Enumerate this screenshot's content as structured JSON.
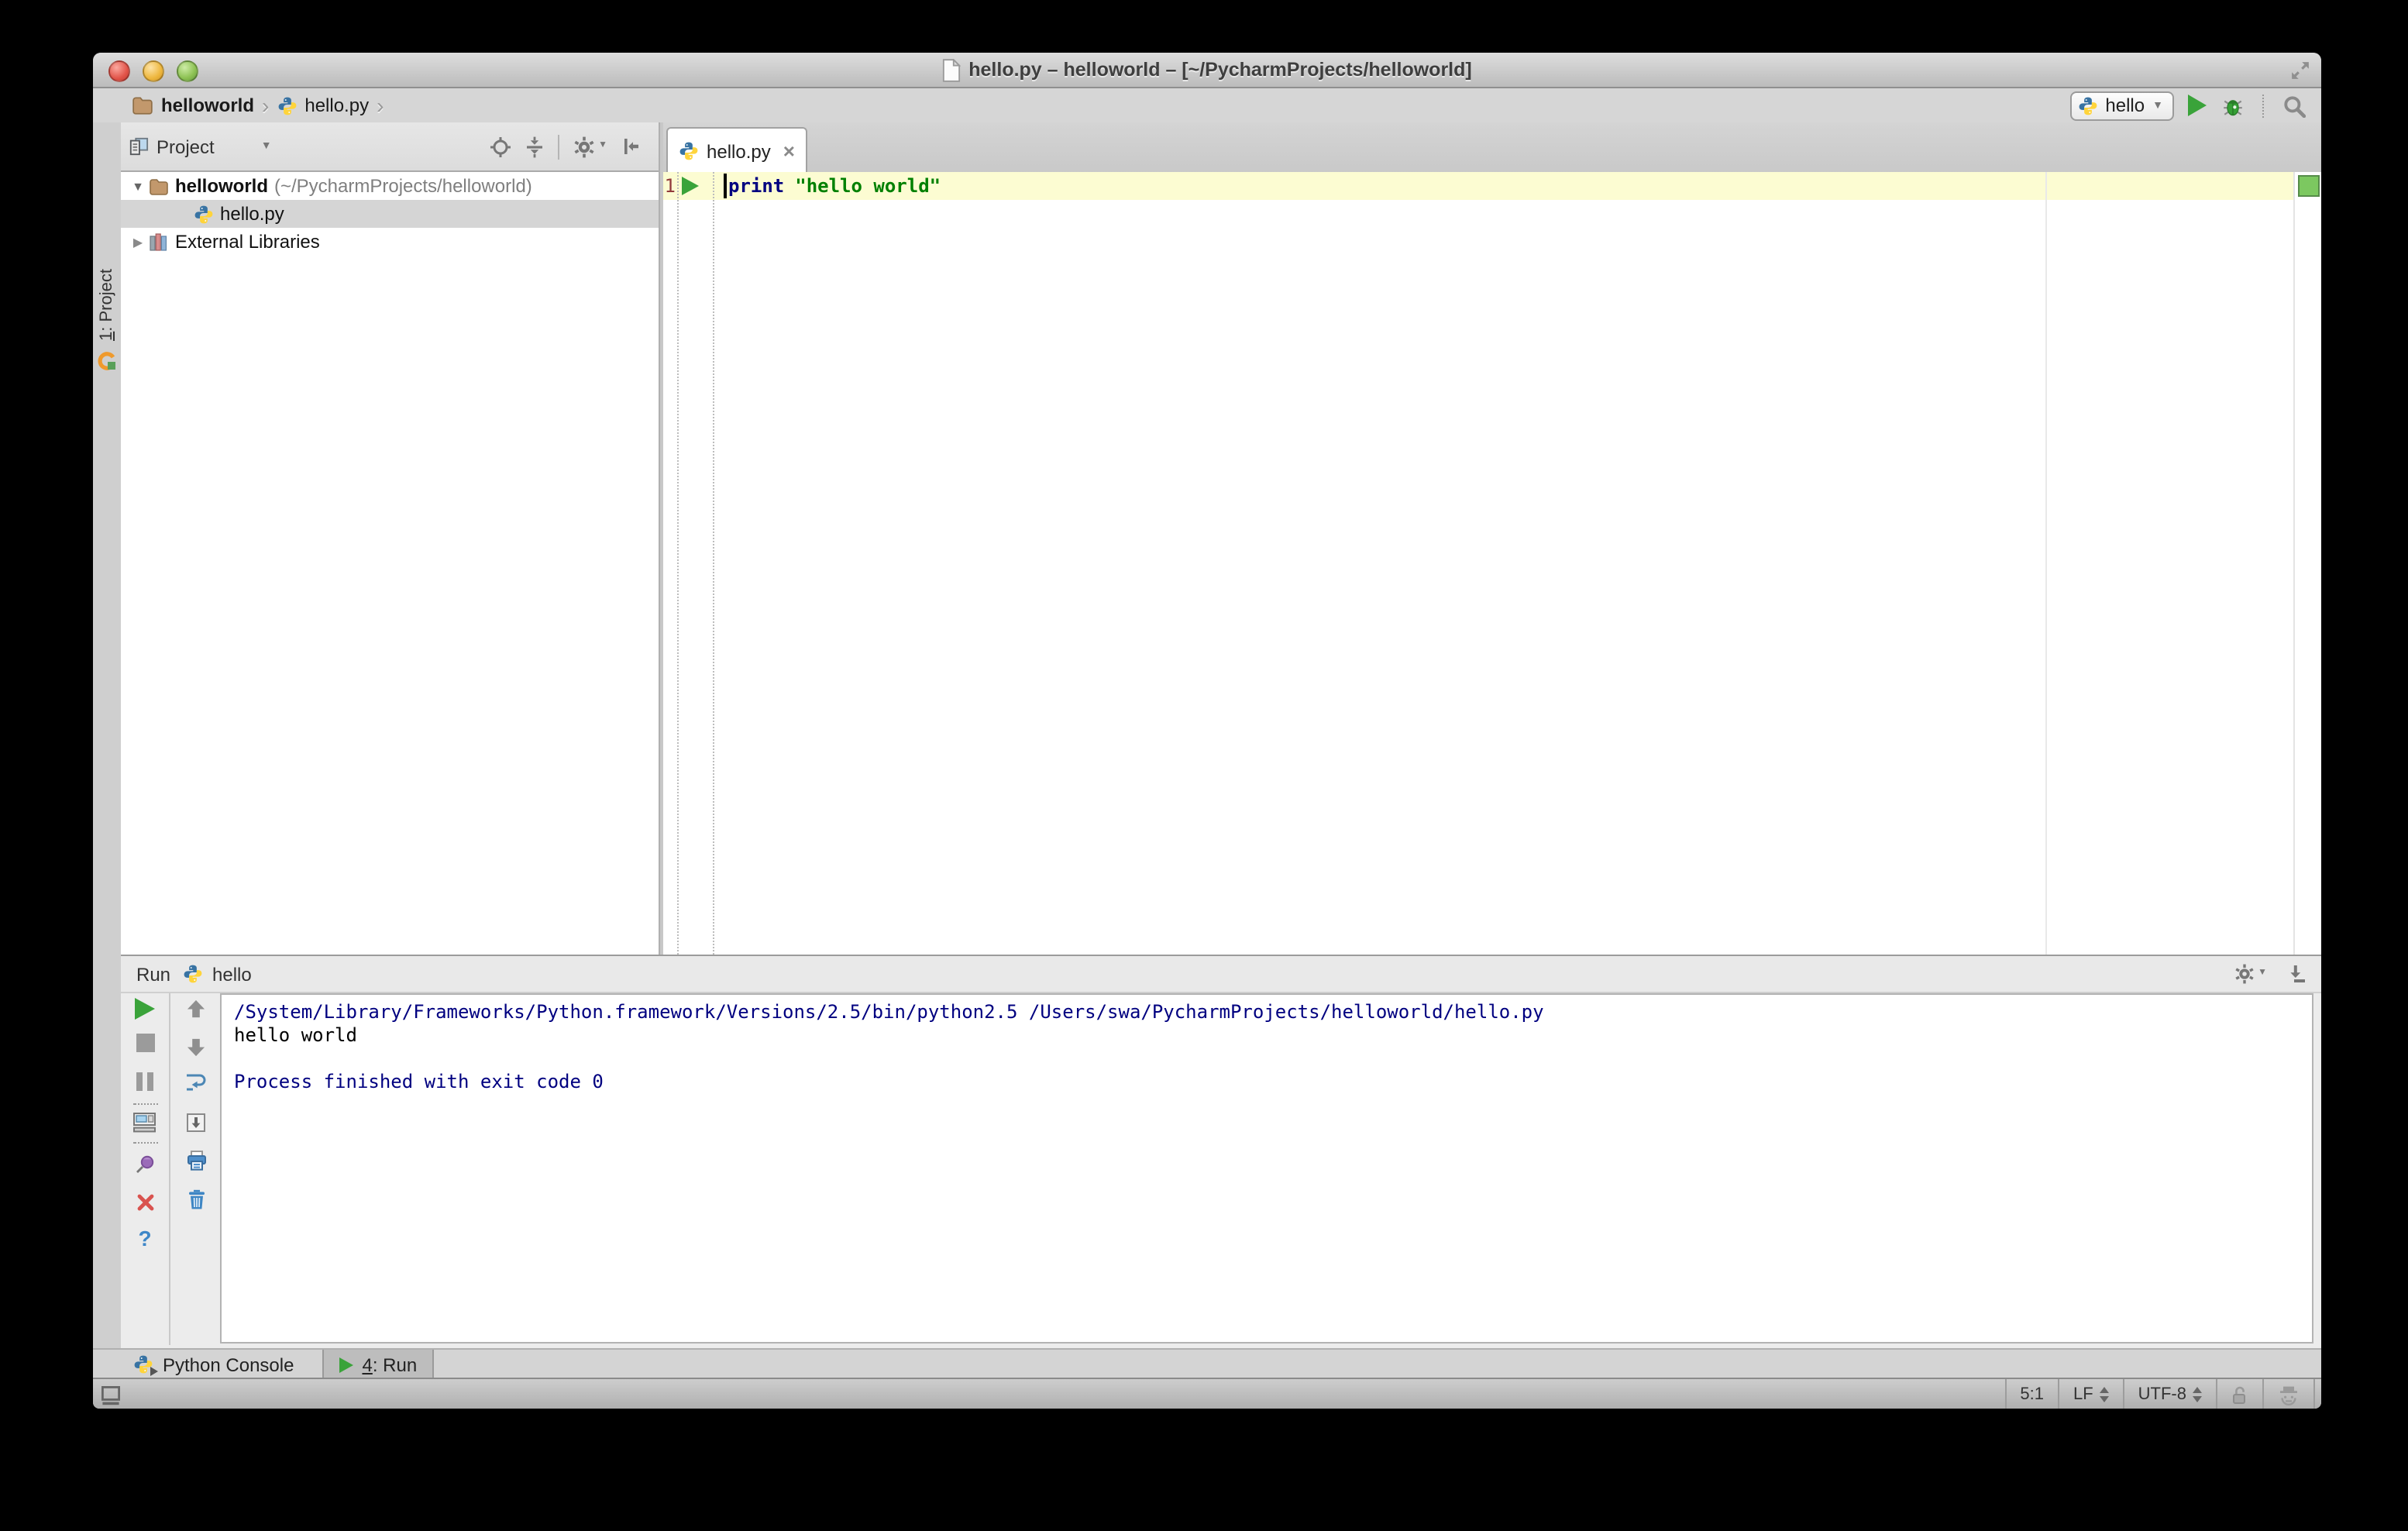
{
  "titlebar": {
    "title": "hello.py – helloworld – [~/PycharmProjects/helloworld]"
  },
  "navbar": {
    "crumb_project": "helloworld",
    "crumb_file": "hello.py"
  },
  "toolbar": {
    "run_config": "hello"
  },
  "left_stripe": {
    "project_btn_number": "1",
    "project_btn_rest": ": Project"
  },
  "project_panel": {
    "title": "Project",
    "tree": {
      "root_name": "helloworld",
      "root_path": "(~/PycharmProjects/helloworld)",
      "file": "hello.py",
      "libraries": "External Libraries"
    }
  },
  "editor": {
    "tab_label": "hello.py",
    "line_number": "1",
    "code_keyword": "print",
    "code_string": "\"hello world\""
  },
  "run_panel": {
    "label": "Run",
    "config": "hello",
    "console": {
      "command_line": "/System/Library/Frameworks/Python.framework/Versions/2.5/bin/python2.5 /Users/swa/PycharmProjects/helloworld/hello.py",
      "output_line": "hello world",
      "exit_line": "Process finished with exit code 0"
    }
  },
  "bottom_bar": {
    "python_console_label": "Python Console",
    "run_tab_number": "4",
    "run_tab_rest": ": Run"
  },
  "status_bar": {
    "caret_position": "5:1",
    "line_separator": "LF",
    "encoding": "UTF-8"
  },
  "icons": {
    "chevron_separator": "›",
    "dropdown_arrow": "▼",
    "tree_expanded": "▼",
    "tree_collapsed": "▶",
    "tab_close": "×",
    "help": "?"
  },
  "colors": {
    "keyword": "#000080",
    "string": "#008000",
    "current_line_bg": "#FCFCD2",
    "console_info": "#000080",
    "console_stdout": "#000000",
    "run_green": "#3AA33A",
    "inspection_ok_green": "#7CC860",
    "selection_bg": "#D5D5D5",
    "line_number": "#923B3B"
  }
}
